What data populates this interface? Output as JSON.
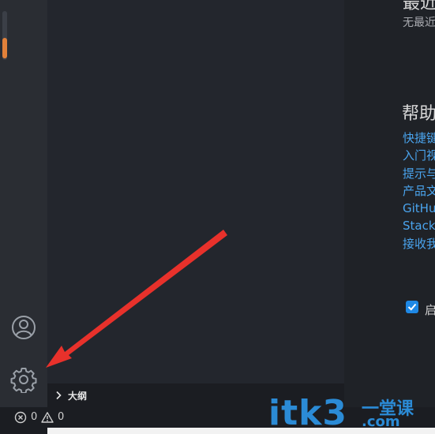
{
  "welcome": {
    "recent_title": "最近",
    "recent_empty": "无最近",
    "help_title": "帮助",
    "help_links": [
      "快捷键",
      "入门视",
      "提示与",
      "产品文",
      "GitHu",
      "Stack",
      "接收我"
    ],
    "startup_label": "启",
    "startup_checked": true
  },
  "side_panel": {
    "outline_label": "大纲"
  },
  "status_bar": {
    "errors": "0",
    "warnings": "0"
  },
  "watermark": {
    "text": "itk3",
    "sub1": "一堂课",
    "sub2": ".com"
  },
  "colors": {
    "accent_orange": "#e2813a",
    "link_blue": "#4aa4ee",
    "arrow_red": "#e8312b"
  },
  "icons": [
    "account-icon",
    "gear-icon",
    "chevron-right-icon",
    "error-icon",
    "warning-icon",
    "checkbox-icon"
  ]
}
